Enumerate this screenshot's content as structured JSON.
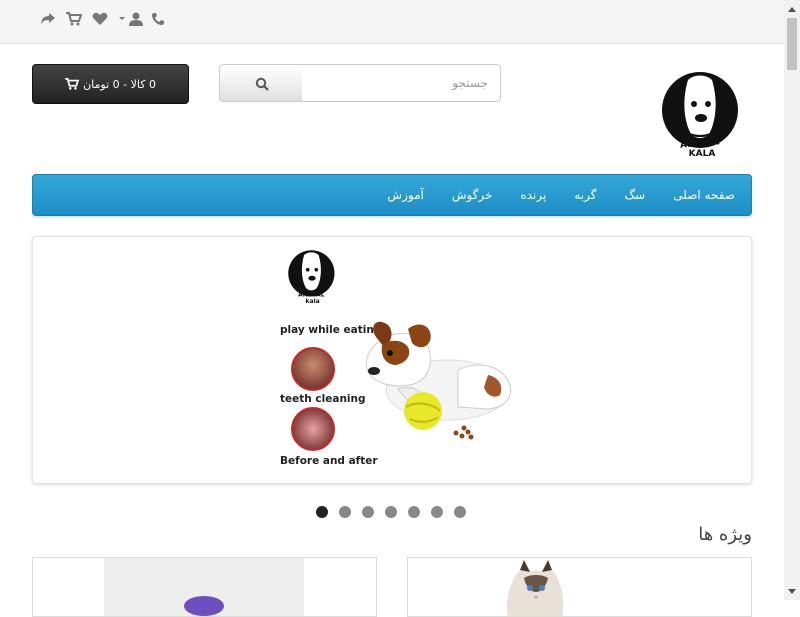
{
  "search": {
    "placeholder": "جستجو"
  },
  "cart": {
    "label": "0 کالا - 0 تومان"
  },
  "menu": {
    "items": [
      {
        "label": "صفحه اصلی"
      },
      {
        "label": "سگ"
      },
      {
        "label": "گربه"
      },
      {
        "label": "پرنده"
      },
      {
        "label": "خرگوش"
      },
      {
        "label": "آموزش"
      }
    ]
  },
  "banner": {
    "labels": [
      "play while eating",
      "teeth cleaning",
      "Before and after"
    ]
  },
  "section": {
    "featured_title": "ویژه ها"
  },
  "carousel": {
    "total_slides": 7,
    "active_index": 0
  },
  "icons": {
    "topbar": [
      "share-icon",
      "cart-icon",
      "heart-icon",
      "user-icon",
      "phone-icon"
    ]
  },
  "colors": {
    "menu_blue": "#2a9fd6",
    "topbar_bg": "#f5f5f5",
    "cart_dark": "#303030",
    "dot_active": "#222222",
    "dot_inactive": "#888888"
  }
}
